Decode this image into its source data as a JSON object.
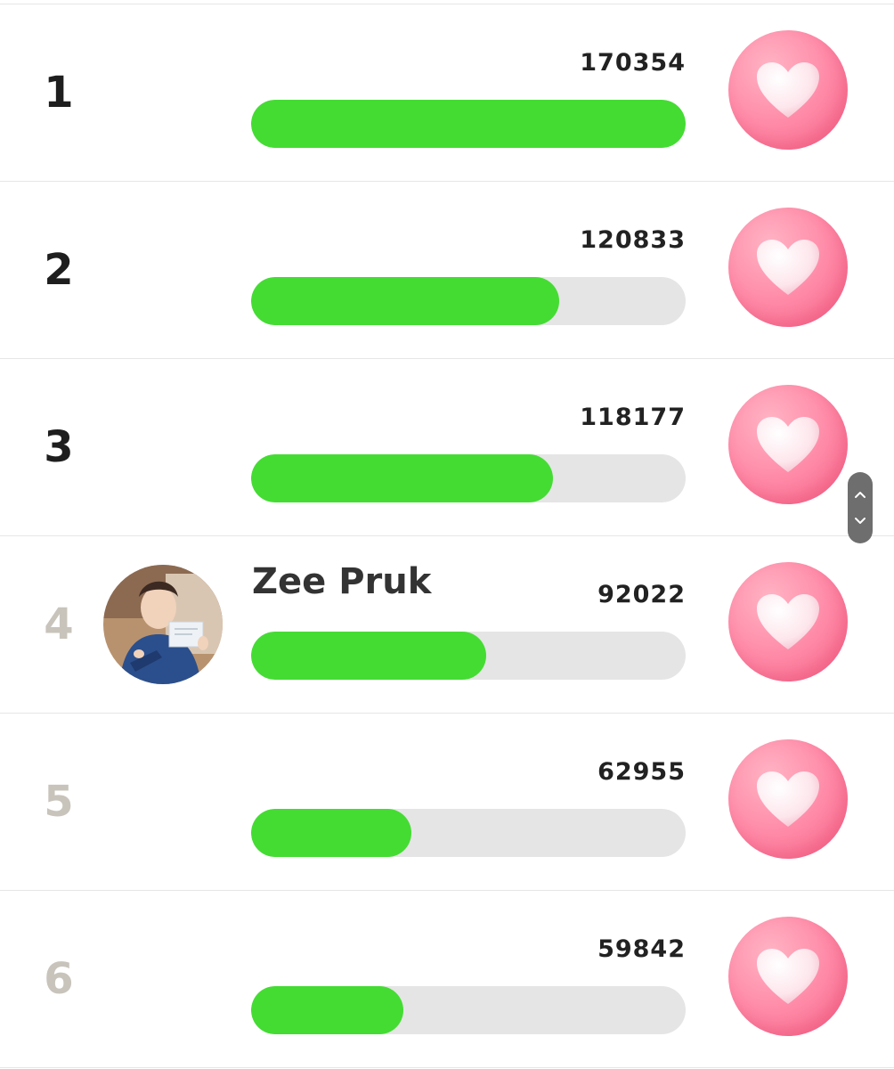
{
  "rows": [
    {
      "rank": "1",
      "name": "",
      "votes": "170354",
      "progress": 1.0
    },
    {
      "rank": "2",
      "name": "",
      "votes": "120833",
      "progress": 0.7093
    },
    {
      "rank": "3",
      "name": "",
      "votes": "118177",
      "progress": 0.6937
    },
    {
      "rank": "4",
      "name": "Zee Pruk",
      "votes": "92022",
      "progress": 0.5402
    },
    {
      "rank": "5",
      "name": "",
      "votes": "62955",
      "progress": 0.3696
    },
    {
      "rank": "6",
      "name": "",
      "votes": "59842",
      "progress": 0.3513
    }
  ],
  "colors": {
    "bar_fill": "#44dc33",
    "bar_track": "#e5e5e5",
    "rank_top": "#1e1e1e",
    "rank_other": "#c8c4bc",
    "heart_button": "#ff8fab"
  },
  "icons": {
    "vote": "heart-icon",
    "scroll_up": "chevron-up-icon",
    "scroll_down": "chevron-down-icon"
  }
}
